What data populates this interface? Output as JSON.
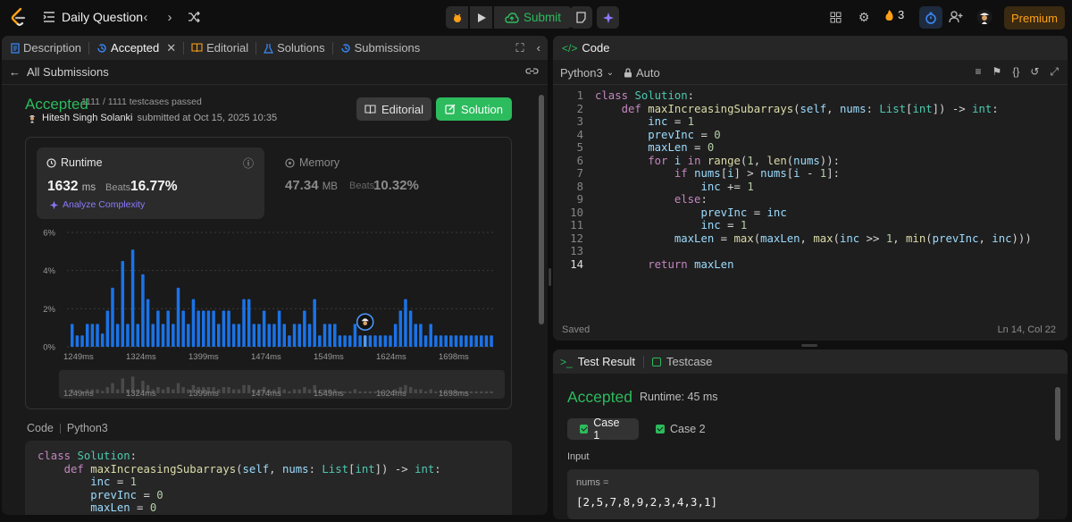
{
  "topbar": {
    "title": "Daily Question",
    "submit_label": "Submit",
    "streak": "3",
    "premium_label": "Premium"
  },
  "left": {
    "tabs": [
      {
        "label": "Description"
      },
      {
        "label": "Accepted"
      },
      {
        "label": "Editorial"
      },
      {
        "label": "Solutions"
      },
      {
        "label": "Submissions"
      }
    ],
    "back_label": "All Submissions",
    "status": "Accepted",
    "testcases": "1111 / 1111 testcases passed",
    "author": "Hitesh Singh Solanki",
    "submitted": "submitted at Oct 15, 2025 10:35",
    "editorial_btn": "Editorial",
    "solution_btn": "Solution",
    "runtime": {
      "label": "Runtime",
      "value": "1632",
      "unit": "ms",
      "beats_label": "Beats",
      "beats": "16.77%",
      "analyze": "Analyze Complexity"
    },
    "memory": {
      "label": "Memory",
      "value": "47.34",
      "unit": "MB",
      "beats_label": "Beats",
      "beats": "10.32%"
    },
    "code_label": "Code",
    "code_lang": "Python3"
  },
  "chart_data": {
    "type": "bar",
    "title": "",
    "xlabel": "",
    "ylabel": "",
    "ylim": [
      0,
      6
    ],
    "y_ticks": [
      "0%",
      "2%",
      "4%",
      "6%"
    ],
    "x_ticks": [
      "1249ms",
      "1324ms",
      "1399ms",
      "1474ms",
      "1549ms",
      "1624ms",
      "1698ms"
    ],
    "highlight_index": 58,
    "values": [
      1.2,
      0.6,
      0.6,
      1.2,
      1.2,
      1.2,
      0.7,
      1.9,
      3.1,
      1.2,
      4.5,
      1.2,
      5.1,
      1.2,
      3.8,
      2.5,
      1.2,
      1.9,
      1.2,
      1.9,
      1.2,
      3.1,
      1.9,
      1.2,
      2.5,
      1.9,
      1.9,
      1.9,
      1.9,
      1.2,
      1.9,
      1.9,
      1.2,
      1.2,
      2.5,
      2.5,
      1.2,
      1.2,
      1.9,
      1.2,
      1.2,
      1.9,
      1.2,
      0.6,
      1.2,
      1.2,
      1.9,
      1.2,
      2.5,
      0.6,
      1.2,
      1.2,
      1.2,
      0.6,
      0.6,
      0.6,
      1.2,
      0.6,
      0.6,
      0.6,
      0.6,
      0.6,
      0.6,
      0.6,
      1.2,
      1.9,
      2.5,
      1.9,
      1.2,
      1.2,
      0.6,
      1.2,
      0.6,
      0.6,
      0.6,
      0.6,
      0.6,
      0.6,
      0.6,
      0.6,
      0.6,
      0.6,
      0.6,
      0.6
    ]
  },
  "code": {
    "header": "Code",
    "language": "Python3",
    "mode": "Auto",
    "saved": "Saved",
    "cursor": "Ln 14, Col 22",
    "lines": [
      "class Solution:",
      "    def maxIncreasingSubarrays(self, nums: List[int]) -> int:",
      "        inc = 1",
      "        prevInc = 0",
      "        maxLen = 0",
      "        for i in range(1, len(nums)):",
      "            if nums[i] > nums[i - 1]:",
      "                inc += 1",
      "            else:",
      "                prevInc = inc",
      "                inc = 1",
      "            maxLen = max(maxLen, max(inc >> 1, min(prevInc, inc)))",
      "",
      "        return maxLen"
    ]
  },
  "preview_code": {
    "lines": [
      "class Solution:",
      "    def maxIncreasingSubarrays(self, nums: List[int]) -> int:",
      "        inc = 1",
      "        prevInc = 0",
      "        maxLen = 0"
    ]
  },
  "test": {
    "tab_result": "Test Result",
    "tab_testcase": "Testcase",
    "status": "Accepted",
    "runtime": "Runtime: 45 ms",
    "case1": "Case 1",
    "case2": "Case 2",
    "input_label": "Input",
    "input_name": "nums =",
    "input_value": "[2,5,7,8,9,2,3,4,3,1]"
  },
  "colors": {
    "accent": "#2cbb5d",
    "bar": "#1a73e8",
    "premium": "#ffa116"
  }
}
